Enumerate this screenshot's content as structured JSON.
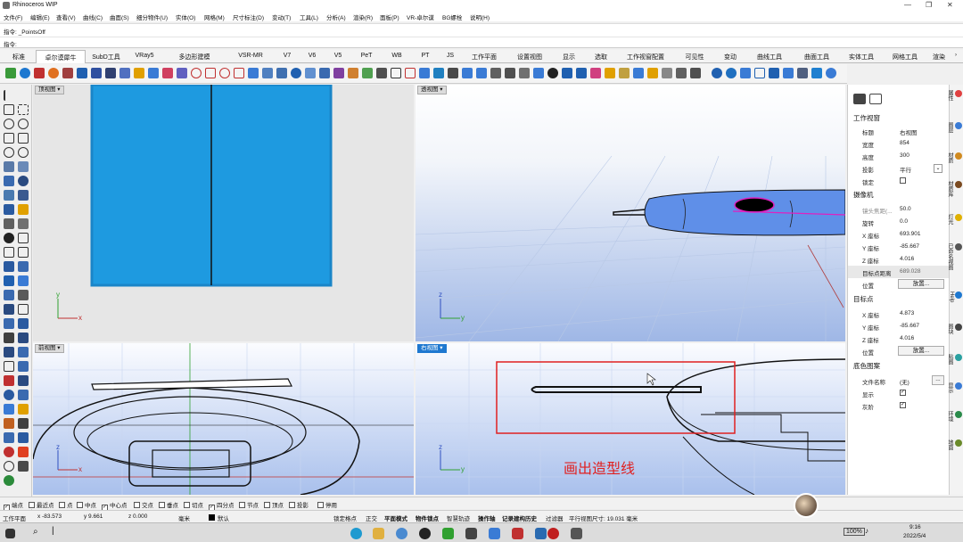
{
  "window": {
    "title": "Rhinoceros WIP",
    "controls": [
      "—",
      "❐",
      "✕"
    ]
  },
  "menu": [
    "文件(F)",
    "编辑(E)",
    "查看(V)",
    "曲线(C)",
    "曲面(S)",
    "细分物件(U)",
    "实体(O)",
    "网格(M)",
    "尺寸标注(D)",
    "变动(T)",
    "工具(L)",
    "分析(A)",
    "渲染(R)",
    "面板(P)",
    "VR-卓尔谟",
    "BG螺栓",
    "说明(H)"
  ],
  "command": {
    "history": "指令: _PointsOff",
    "prompt": "指令:"
  },
  "tabs": [
    "标准",
    "卓尔谟犀牛",
    "SubD工具",
    "VRay5",
    "多边形建模",
    "VSR-MR",
    "V7",
    "V6",
    "V5",
    "PeT",
    "WB",
    "PT",
    "JS",
    "工作平面",
    "设置视图",
    "显示",
    "选取",
    "工作视窗配置",
    "可见性",
    "变动",
    "曲线工具",
    "曲面工具",
    "实体工具",
    "网格工具",
    "渲染"
  ],
  "active_tab": "卓尔谟犀牛",
  "viewports": {
    "top": "顶视图",
    "perspective": "透视图",
    "front": "前视图",
    "right": "右视图"
  },
  "axes": {
    "x": "x",
    "y": "y",
    "z": "z"
  },
  "annotation": "画出造型线",
  "panel": {
    "section_viewport": "工作视窗",
    "title_label": "标题",
    "title_value": "右视图",
    "width_label": "宽度",
    "width_value": "854",
    "height_label": "高度",
    "height_value": "300",
    "projection_label": "投影",
    "projection_value": "平行",
    "lock_label": "锁定",
    "section_camera": "摄像机",
    "lens_label": "镜头焦距(...",
    "lens_value": "50.0",
    "rotation_label": "旋转",
    "rotation_value": "0.0",
    "cx_label": "X 座标",
    "cx_value": "693.901",
    "cy_label": "Y 座标",
    "cy_value": "-85.667",
    "cz_label": "Z 座标",
    "cz_value": "4.016",
    "target_dist_label": "目标点距离",
    "target_dist_value": "689.028",
    "position_label": "位置",
    "place_button": "放置...",
    "section_target": "目标点",
    "tx_label": "X 座标",
    "tx_value": "4.873",
    "ty_label": "Y 座标",
    "ty_value": "-85.667",
    "tz_label": "Z 座标",
    "tz_value": "4.016",
    "tposition_label": "位置",
    "tplace_button": "放置...",
    "section_bg": "底色图案",
    "file_label": "文件名称",
    "file_value": "(无)",
    "file_button": "...",
    "show_label": "显示",
    "gray_label": "灰阶"
  },
  "side_tabs": [
    {
      "label": "属性",
      "color": "#e04040"
    },
    {
      "label": "图层",
      "color": "#3a7bd5"
    },
    {
      "label": "材质",
      "color": "#d08a20"
    },
    {
      "label": "材质库",
      "color": "#7a4a20"
    },
    {
      "label": "灯光",
      "color": "#e0b000"
    },
    {
      "label": "已命名视图",
      "color": "#555555"
    },
    {
      "label": "Help",
      "color": "#1e78d0"
    },
    {
      "label": "图块",
      "color": "#444444"
    },
    {
      "label": "贴图",
      "color": "#2aa0a0"
    },
    {
      "label": "显示",
      "color": "#3a7bd5"
    },
    {
      "label": "环境",
      "color": "#2a8a4a"
    },
    {
      "label": "地面",
      "color": "#6a8a2a"
    }
  ],
  "osnaps": [
    {
      "label": "端点",
      "on": true
    },
    {
      "label": "最近点",
      "on": false
    },
    {
      "label": "点",
      "on": false
    },
    {
      "label": "中点",
      "on": false
    },
    {
      "label": "中心点",
      "on": true
    },
    {
      "label": "交点",
      "on": false
    },
    {
      "label": "垂点",
      "on": false
    },
    {
      "label": "切点",
      "on": false
    },
    {
      "label": "四分点",
      "on": true
    },
    {
      "label": "节点",
      "on": false
    },
    {
      "label": "顶点",
      "on": false
    },
    {
      "label": "投影",
      "on": false
    },
    {
      "label": "停用",
      "on": false
    }
  ],
  "status": {
    "cplane": "工作平面",
    "x": "x -83.573",
    "y": "y 9.661",
    "z": "z 0.000",
    "unit": "毫米",
    "layer": "默认",
    "toggles": [
      "锁定格点",
      "正交",
      "平面模式",
      "物件锁点",
      "智慧轨迹",
      "操作轴",
      "记录建构历史",
      "过滤器"
    ],
    "viewsize": "平行视图尺寸: 19.031 毫米"
  },
  "taskbar": {
    "battery": "100%",
    "time": "9:16",
    "date": "2022/5/4"
  },
  "colors": {
    "accent": "#1e78d0",
    "annotation": "#e02020",
    "grid": "#7aa0d8"
  }
}
